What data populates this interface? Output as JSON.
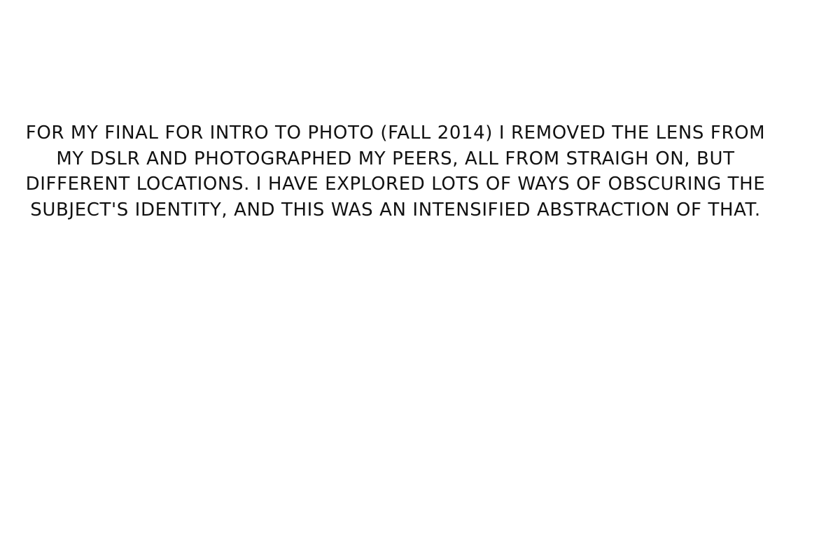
{
  "statement": {
    "text": "for my final for intro to photo (fall 2014) i removed the lens from my dslr and photographed my peers, all from straigh on, but different locations. i have explored lots of ways of obscuring the subject's identity, and this was an intensified abstraction of that.",
    "text_color": "#111111"
  },
  "page": {
    "background": "#ffffff"
  }
}
